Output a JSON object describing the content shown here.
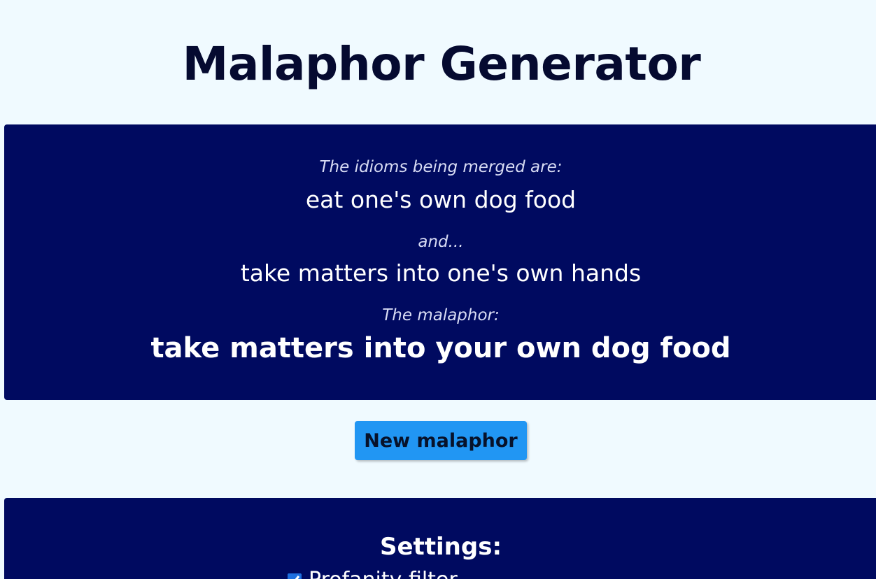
{
  "header": {
    "title": "Malaphor Generator"
  },
  "result": {
    "intro_caption": "The idioms being merged are:",
    "idiom_one": "eat one's own dog food",
    "and_caption": "and...",
    "idiom_two": "take matters into one's own hands",
    "malaphor_caption": "The malaphor:",
    "malaphor": "take matters into your own dog food"
  },
  "actions": {
    "new_button_label": "New malaphor"
  },
  "settings": {
    "heading": "Settings:",
    "profanity_filter_label": "Profanity filter",
    "profanity_filter_checked": true
  },
  "colors": {
    "background": "#f0faff",
    "panel": "#000a60",
    "button": "#2196f3",
    "title": "#050a30"
  }
}
